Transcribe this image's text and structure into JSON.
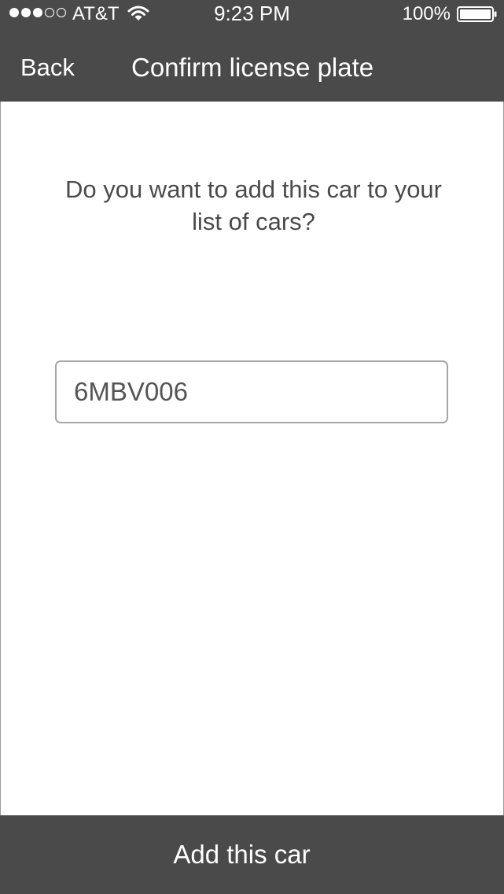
{
  "status_bar": {
    "signal_bars_filled": 3,
    "signal_bars_total": 5,
    "carrier": "AT&T",
    "wifi_icon": "wifi-icon",
    "time": "9:23 PM",
    "battery_percent": "100%",
    "battery_icon": "battery-full-icon"
  },
  "nav": {
    "back_label": "Back",
    "title": "Confirm license plate"
  },
  "main": {
    "question": "Do you want to add this car to your list of cars?",
    "plate_value": "6MBV006"
  },
  "footer": {
    "add_button_label": "Add this car"
  },
  "colors": {
    "bar_background": "#4a4a4a",
    "content_background": "#ffffff",
    "text_gray": "#4a4a4a",
    "field_border": "#a6a6a6"
  }
}
